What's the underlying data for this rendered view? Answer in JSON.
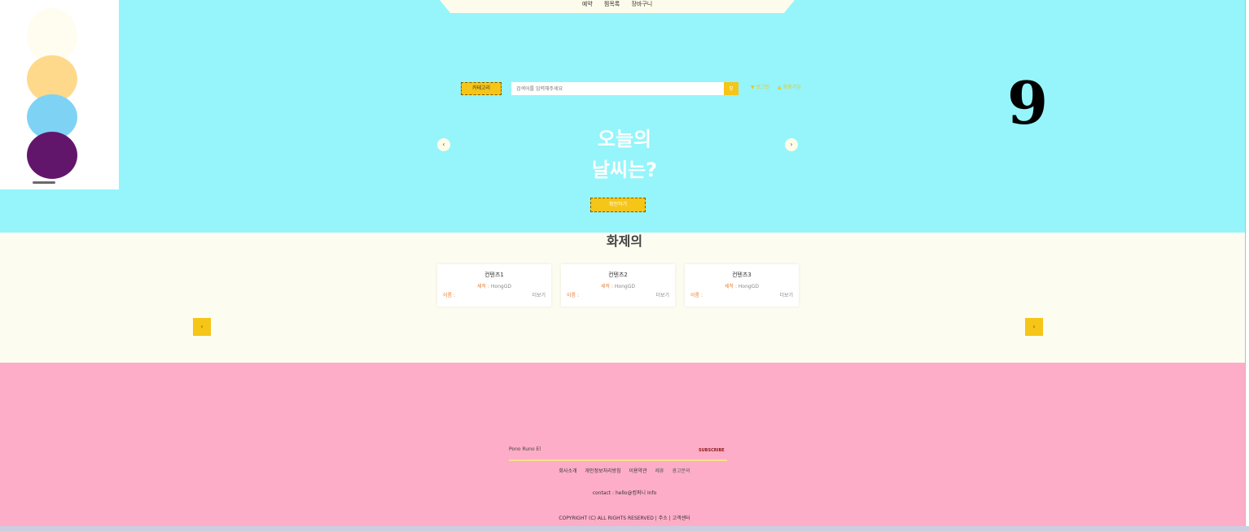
{
  "top_nav": {
    "links": [
      "예약",
      "찜목록",
      "장바구니"
    ]
  },
  "logo": {
    "colors": [
      "#fffdf0",
      "#ffd98b",
      "#7ed3f5",
      "#62166b"
    ]
  },
  "badge": {
    "text": "9"
  },
  "search": {
    "category_label": "카테고리",
    "placeholder": "검색어를 입력해주세요",
    "button_icon": "search-icon",
    "auth_login": "로그인",
    "auth_signup": "회원가입"
  },
  "hero": {
    "line1": "오늘의",
    "line2": "날씨는?",
    "button_label": "확인하기",
    "prev_icon": "chevron-left-icon",
    "next_icon": "chevron-right-icon"
  },
  "trending": {
    "title": "화제의",
    "cards": [
      {
        "title": "컨텐츠1",
        "writer_label": "세작 :",
        "writer": "HongGD",
        "name_label": "이름 :",
        "more": "더보기"
      },
      {
        "title": "컨텐츠2",
        "writer_label": "세작 :",
        "writer": "HongGD",
        "name_label": "이름 :",
        "more": "더보기"
      },
      {
        "title": "컨텐츠3",
        "writer_label": "세작 :",
        "writer": "HongGD",
        "name_label": "이름 :",
        "more": "더보기"
      }
    ]
  },
  "footer": {
    "brand": "Pono Runo El",
    "right_text": "SUBSCRIBE",
    "nav": [
      "회사소개",
      "개인정보처리방침",
      "이용약관",
      "제휴",
      "광고문의"
    ],
    "middle": "contact : hello@컴퍼니 Info",
    "bottom": "COPYRIGHT (C) ALL RIGHTS RESERVED | 주소 | 고객센터"
  },
  "colors": {
    "hero_bg": "#95f5fa",
    "accent": "#f5c518",
    "trend_bg": "#fdfcf0",
    "footer_bg": "#fdadc7"
  }
}
